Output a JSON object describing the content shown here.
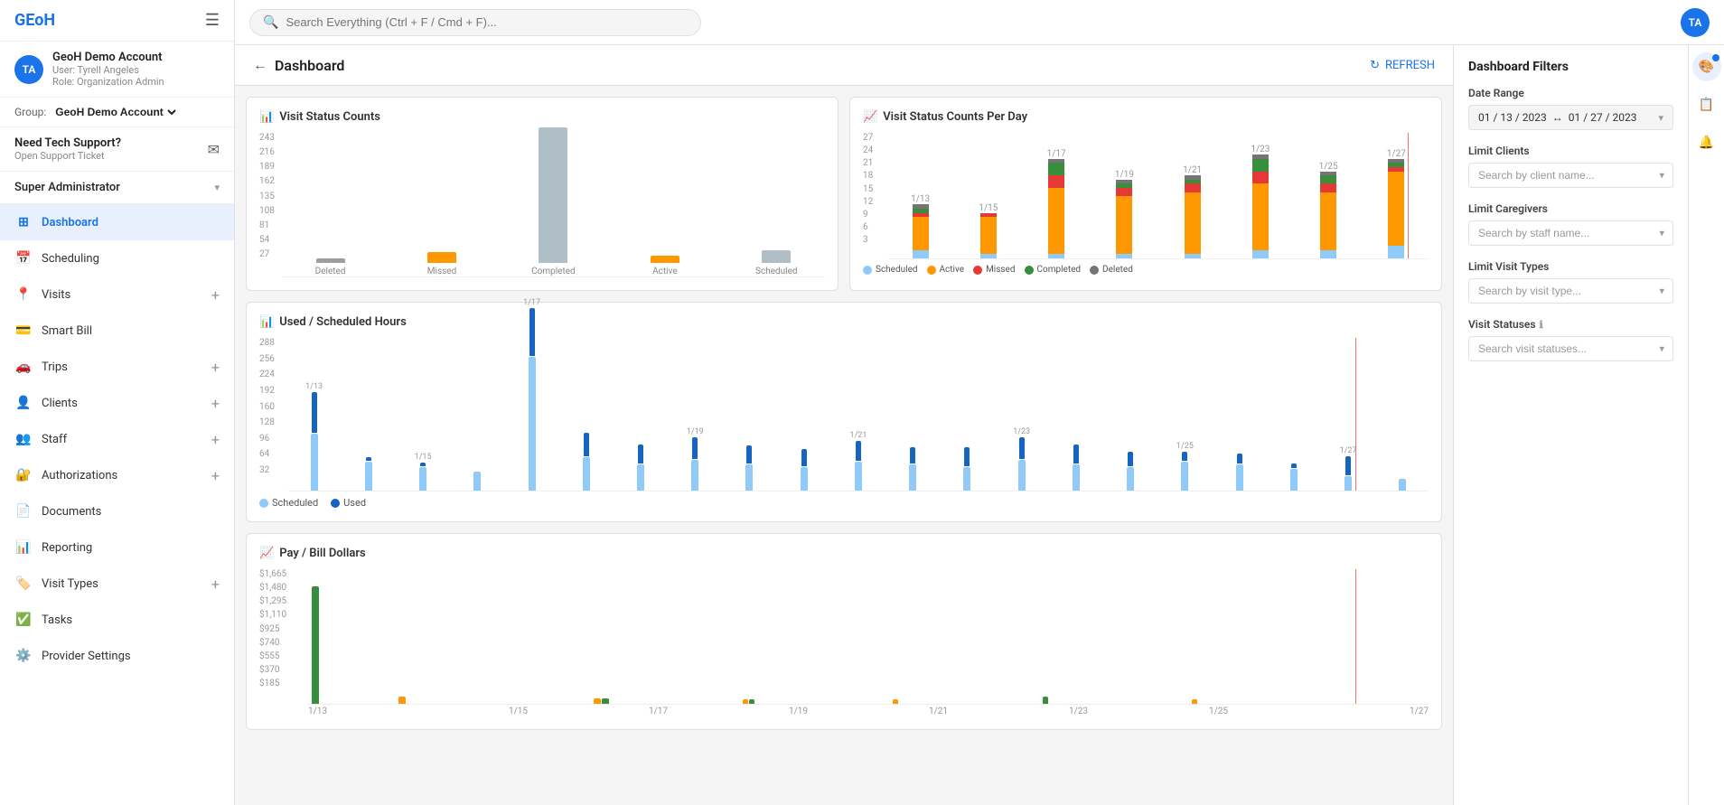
{
  "app": {
    "logo": "GEoH",
    "menu_icon": "≡"
  },
  "user": {
    "initials": "TA",
    "name": "GeoH Demo Account",
    "sub1": "User: Tyrell Angeles",
    "sub2": "Role: Organization Admin"
  },
  "group": {
    "label": "Group:",
    "value": "GeoH Demo Account"
  },
  "support": {
    "title": "Need Tech Support?",
    "subtitle": "Open Support Ticket"
  },
  "super_admin": {
    "label": "Super Administrator"
  },
  "nav": [
    {
      "id": "dashboard",
      "label": "Dashboard",
      "icon": "⊞",
      "active": true,
      "has_plus": false
    },
    {
      "id": "scheduling",
      "label": "Scheduling",
      "icon": "📅",
      "active": false,
      "has_plus": false
    },
    {
      "id": "visits",
      "label": "Visits",
      "icon": "📍",
      "active": false,
      "has_plus": true
    },
    {
      "id": "smart-bill",
      "label": "Smart Bill",
      "icon": "💳",
      "active": false,
      "has_plus": false
    },
    {
      "id": "trips",
      "label": "Trips",
      "icon": "🚗",
      "active": false,
      "has_plus": true
    },
    {
      "id": "clients",
      "label": "Clients",
      "icon": "👤",
      "active": false,
      "has_plus": true
    },
    {
      "id": "staff",
      "label": "Staff",
      "icon": "👥",
      "active": false,
      "has_plus": true
    },
    {
      "id": "authorizations",
      "label": "Authorizations",
      "icon": "🔐",
      "active": false,
      "has_plus": true
    },
    {
      "id": "documents",
      "label": "Documents",
      "icon": "📄",
      "active": false,
      "has_plus": false
    },
    {
      "id": "reporting",
      "label": "Reporting",
      "icon": "📊",
      "active": false,
      "has_plus": false
    },
    {
      "id": "visit-types",
      "label": "Visit Types",
      "icon": "🏷️",
      "active": false,
      "has_plus": true
    },
    {
      "id": "tasks",
      "label": "Tasks",
      "icon": "✅",
      "active": false,
      "has_plus": false
    },
    {
      "id": "provider-settings",
      "label": "Provider Settings",
      "icon": "⚙️",
      "active": false,
      "has_plus": false
    }
  ],
  "topbar": {
    "search_placeholder": "Search Everything (Ctrl + F / Cmd + F)...",
    "user_initials": "TA"
  },
  "dashboard": {
    "title": "Dashboard",
    "refresh_label": "REFRESH"
  },
  "visit_status_counts": {
    "title": "Visit Status Counts",
    "y_labels": [
      "27",
      "54",
      "81",
      "108",
      "135",
      "162",
      "189",
      "216",
      "243"
    ],
    "bars": [
      {
        "label": "Deleted",
        "value": 8,
        "color": "#9e9e9e",
        "max": 243
      },
      {
        "label": "Missed",
        "value": 18,
        "color": "#ff9800",
        "max": 243
      },
      {
        "label": "Completed",
        "value": 243,
        "color": "#9e9e9e",
        "max": 243
      },
      {
        "label": "Active",
        "value": 12,
        "color": "#ff9800",
        "max": 243
      },
      {
        "label": "Scheduled",
        "value": 22,
        "color": "#b0bec5",
        "max": 243
      }
    ]
  },
  "visit_status_per_day": {
    "title": "Visit Status Counts Per Day",
    "y_labels": [
      "3",
      "6",
      "9",
      "12",
      "15",
      "18",
      "21",
      "24",
      "27"
    ],
    "dates": [
      "1/13",
      "1/15",
      "1/17",
      "1/19",
      "1/21",
      "1/23",
      "1/25",
      "1/27"
    ],
    "legend": [
      {
        "label": "Scheduled",
        "color": "#90caf9"
      },
      {
        "label": "Active",
        "color": "#ff9800"
      },
      {
        "label": "Missed",
        "color": "#e53935"
      },
      {
        "label": "Completed",
        "color": "#388e3c"
      },
      {
        "label": "Deleted",
        "color": "#757575"
      }
    ],
    "stacks": [
      {
        "date": "1/13",
        "scheduled": 2,
        "active": 8,
        "missed": 1,
        "completed": 1,
        "deleted": 1
      },
      {
        "date": "1/15",
        "scheduled": 1,
        "active": 9,
        "missed": 1,
        "completed": 0,
        "deleted": 0
      },
      {
        "date": "1/17",
        "scheduled": 1,
        "active": 16,
        "missed": 3,
        "completed": 3,
        "deleted": 1
      },
      {
        "date": "1/19",
        "scheduled": 1,
        "active": 14,
        "missed": 2,
        "completed": 1,
        "deleted": 1
      },
      {
        "date": "1/21",
        "scheduled": 1,
        "active": 15,
        "missed": 2,
        "completed": 1,
        "deleted": 1
      },
      {
        "date": "1/23",
        "scheduled": 2,
        "active": 16,
        "missed": 3,
        "completed": 3,
        "deleted": 1
      },
      {
        "date": "1/25",
        "scheduled": 2,
        "active": 14,
        "missed": 2,
        "completed": 2,
        "deleted": 1
      },
      {
        "date": "1/27",
        "scheduled": 3,
        "active": 18,
        "missed": 1,
        "completed": 1,
        "deleted": 1
      }
    ]
  },
  "used_scheduled": {
    "title": "Used / Scheduled Hours",
    "y_labels": [
      "32",
      "64",
      "96",
      "128",
      "160",
      "192",
      "224",
      "256",
      "288"
    ],
    "dates": [
      "1/13",
      "1/15",
      "1/17",
      "1/19",
      "1/21",
      "1/23",
      "1/25",
      "1/27"
    ],
    "bars": [
      {
        "date": "1/13",
        "scheduled": 120,
        "used": 85
      },
      {
        "date": "",
        "scheduled": 60,
        "used": 8
      },
      {
        "date": "1/15",
        "scheduled": 50,
        "used": 6
      },
      {
        "date": "",
        "scheduled": 40,
        "used": 0
      },
      {
        "date": "1/17",
        "scheduled": 280,
        "used": 100
      },
      {
        "date": "",
        "scheduled": 70,
        "used": 50
      },
      {
        "date": "",
        "scheduled": 55,
        "used": 40
      },
      {
        "date": "1/19",
        "scheduled": 65,
        "used": 45
      },
      {
        "date": "",
        "scheduled": 55,
        "used": 38
      },
      {
        "date": "",
        "scheduled": 50,
        "used": 35
      },
      {
        "date": "1/21",
        "scheduled": 60,
        "used": 42
      },
      {
        "date": "",
        "scheduled": 55,
        "used": 35
      },
      {
        "date": "",
        "scheduled": 50,
        "used": 40
      },
      {
        "date": "1/23",
        "scheduled": 65,
        "used": 45
      },
      {
        "date": "",
        "scheduled": 55,
        "used": 40
      },
      {
        "date": "",
        "scheduled": 50,
        "used": 30
      },
      {
        "date": "1/25",
        "scheduled": 60,
        "used": 20
      },
      {
        "date": "",
        "scheduled": 55,
        "used": 20
      },
      {
        "date": "",
        "scheduled": 45,
        "used": 10
      },
      {
        "date": "1/27",
        "scheduled": 30,
        "used": 40
      },
      {
        "date": "",
        "scheduled": 25,
        "used": 0
      }
    ],
    "legend": [
      {
        "label": "Scheduled",
        "color": "#90caf9"
      },
      {
        "label": "Used",
        "color": "#1565c0"
      }
    ]
  },
  "pay_bill": {
    "title": "Pay / Bill Dollars",
    "y_labels": [
      "$185",
      "$370",
      "$555",
      "$740",
      "$925",
      "$1,110",
      "$1,295",
      "$1,480",
      "$1,665"
    ],
    "dates": [
      "1/13",
      "1/15",
      "1/17",
      "1/19",
      "1/21",
      "1/23",
      "1/25",
      "1/27"
    ]
  },
  "filters": {
    "title": "Dashboard Filters",
    "date_range_label": "Date Range",
    "date_range_start": "01 / 13 / 2023",
    "date_range_arrow": "↔",
    "date_range_end": "01 / 27 / 2023",
    "limit_clients_label": "Limit Clients",
    "limit_clients_placeholder": "Search by client name...",
    "limit_caregivers_label": "Limit Caregivers",
    "limit_caregivers_placeholder": "Search by staff name...",
    "limit_visit_types_label": "Limit Visit Types",
    "limit_visit_types_placeholder": "Search by visit type...",
    "visit_statuses_label": "Visit Statuses",
    "visit_statuses_placeholder": "Search visit statuses..."
  },
  "colors": {
    "scheduled": "#90caf9",
    "active": "#ff9800",
    "missed": "#e53935",
    "completed": "#388e3c",
    "deleted": "#9e9e9e",
    "used": "#1565c0",
    "pay": "#ff9800",
    "bill": "#388e3c",
    "red_line": "#e53935",
    "accent": "#1a73e8"
  }
}
